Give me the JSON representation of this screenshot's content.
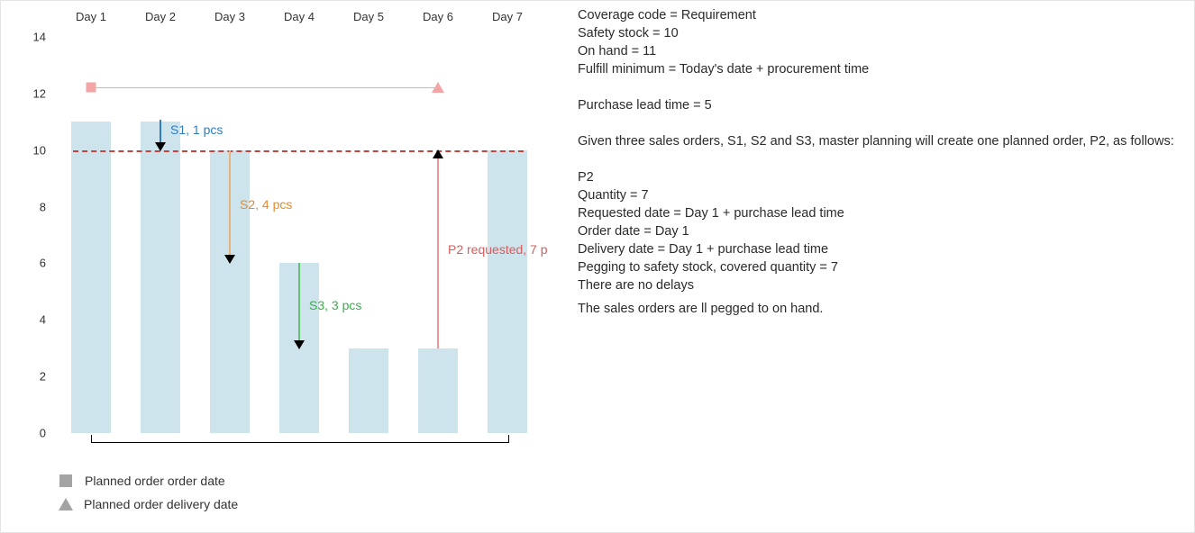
{
  "chart_data": {
    "type": "bar",
    "categories": [
      "Day 1",
      "Day 2",
      "Day 3",
      "Day 4",
      "Day 5",
      "Day 6",
      "Day 7"
    ],
    "values": [
      11,
      11,
      10,
      6,
      3,
      3,
      10
    ],
    "ylim": [
      0,
      14
    ],
    "yticks": [
      0,
      2,
      4,
      6,
      8,
      10,
      12,
      14
    ],
    "safety_stock_line": 10,
    "lead_time_marker": {
      "start_day": 1,
      "end_day": 6,
      "y": 12.2
    },
    "bracket": {
      "start_day": 1,
      "end_day": 7
    },
    "annotations": [
      {
        "id": "s1",
        "label": "S1, 1 pcs",
        "color": "#2f7cc5",
        "arrow_from_day": 2,
        "from_y": 11,
        "to_y": 10
      },
      {
        "id": "s2",
        "label": "S2, 4 pcs",
        "color": "#e68a2e",
        "arrow_from_day": 3,
        "from_y": 10,
        "to_y": 6
      },
      {
        "id": "s3",
        "label": "S3, 3 pcs",
        "color": "#3aae4a",
        "arrow_from_day": 4,
        "from_y": 6,
        "to_y": 3
      },
      {
        "id": "p2",
        "label": "P2 requested, 7 p",
        "color": "#e06666",
        "arrow_from_day": 6,
        "from_y": 3,
        "to_y": 10,
        "direction": "up"
      }
    ]
  },
  "legend": {
    "order_date": "Planned order order date",
    "delivery_date": "Planned order delivery date"
  },
  "side": {
    "l1": "Coverage code = Requirement",
    "l2": "Safety stock = 10",
    "l3": "On hand = 11",
    "l4": "Fulfill minimum = Today's date + procurement time",
    "l5": "Purchase lead time = 5",
    "l6": "Given three sales orders, S1, S2 and S3, master planning will create one planned order, P2, as follows:",
    "l7": "P2",
    "l8": "Quantity = 7",
    "l9": "Requested date = Day 1 + purchase lead time",
    "l10": "Order date = Day 1",
    "l11": "Delivery date = Day 1 + purchase lead time",
    "l12": "Pegging to safety stock, covered quantity = 7",
    "l13": "There are no delays",
    "l14": " The sales orders are ll pegged to on hand."
  },
  "yticks": {
    "0": "0",
    "2": "2",
    "4": "4",
    "6": "6",
    "8": "8",
    "10": "10",
    "12": "12",
    "14": "14"
  },
  "xticks": {
    "0": "Day 1",
    "1": "Day 2",
    "2": "Day 3",
    "3": "Day 4",
    "4": "Day 5",
    "5": "Day 6",
    "6": "Day 7"
  },
  "ann_labels": {
    "s1": "S1, 1 pcs",
    "s2": "S2, 4 pcs",
    "s3": "S3, 3 pcs",
    "p2": "P2 requested, 7 p"
  }
}
